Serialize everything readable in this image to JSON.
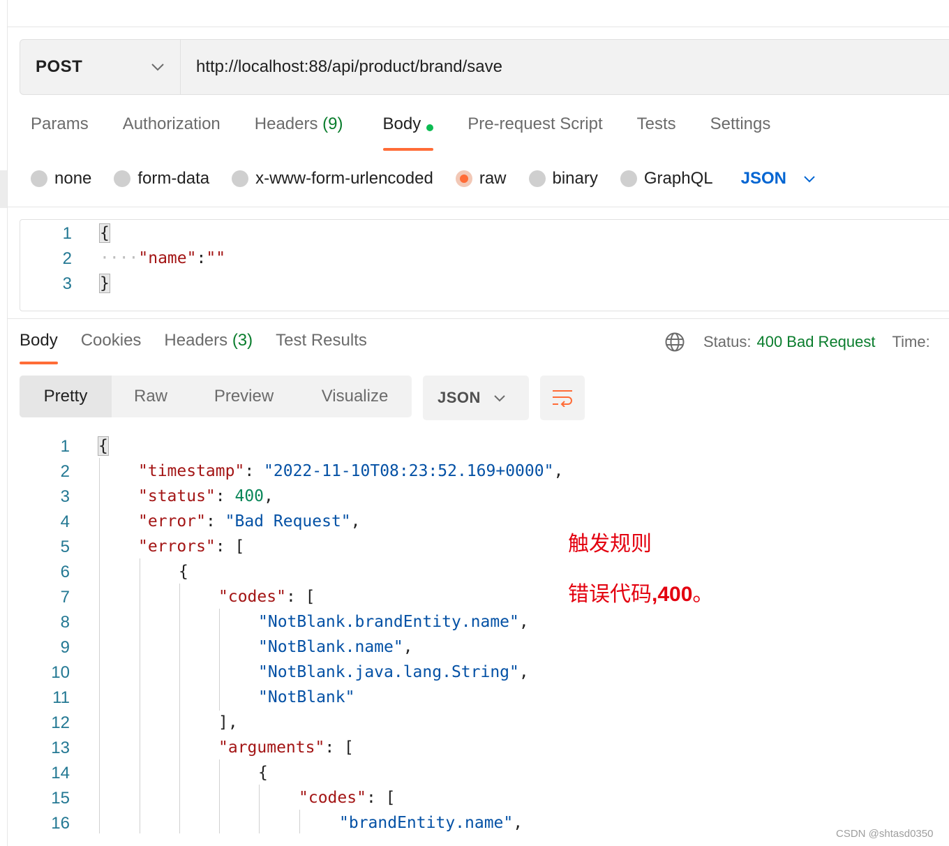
{
  "request": {
    "method": "POST",
    "url": "http://localhost:88/api/product/brand/save"
  },
  "request_tabs": [
    {
      "label": "Params"
    },
    {
      "label": "Authorization"
    },
    {
      "label": "Headers",
      "count": "(9)"
    },
    {
      "label": "Body",
      "active": true,
      "indicator": "green-dot"
    },
    {
      "label": "Pre-request Script"
    },
    {
      "label": "Tests"
    },
    {
      "label": "Settings"
    }
  ],
  "body_types": [
    {
      "label": "none"
    },
    {
      "label": "form-data"
    },
    {
      "label": "x-www-form-urlencoded"
    },
    {
      "label": "raw",
      "selected": true
    },
    {
      "label": "binary"
    },
    {
      "label": "GraphQL"
    }
  ],
  "body_language": "JSON",
  "request_body_lines": [
    "1",
    "2",
    "3"
  ],
  "request_body": {
    "open": "{",
    "key": "\"name\"",
    "colon": ":",
    "value": "\"\"",
    "close": "}"
  },
  "response_tabs": [
    {
      "label": "Body",
      "active": true
    },
    {
      "label": "Cookies"
    },
    {
      "label": "Headers",
      "count": "(3)"
    },
    {
      "label": "Test Results"
    }
  ],
  "status": {
    "label": "Status:",
    "value": "400 Bad Request",
    "time_label": "Time:"
  },
  "view_modes": [
    "Pretty",
    "Raw",
    "Preview",
    "Visualize"
  ],
  "response_format": "JSON",
  "response_lines": [
    "1",
    "2",
    "3",
    "4",
    "5",
    "6",
    "7",
    "8",
    "9",
    "10",
    "11",
    "12",
    "13",
    "14",
    "15",
    "16"
  ],
  "response": {
    "timestamp_key": "\"timestamp\"",
    "timestamp_val": "\"2022-11-10T08:23:52.169+0000\"",
    "status_key": "\"status\"",
    "status_val": "400",
    "error_key": "\"error\"",
    "error_val": "\"Bad Request\"",
    "errors_key": "\"errors\"",
    "codes_key": "\"codes\"",
    "code1": "\"NotBlank.brandEntity.name\"",
    "code2": "\"NotBlank.name\"",
    "code3": "\"NotBlank.java.lang.String\"",
    "code4": "\"NotBlank\"",
    "arguments_key": "\"arguments\"",
    "arg_code1": "\"brandEntity.name\""
  },
  "annotation": {
    "line1": "触发规则",
    "line2_prefix": "错误代码",
    "line2_bold": ",400",
    "line2_suffix": "。"
  },
  "watermark": "CSDN @shtasd0350",
  "colors": {
    "accent": "#ff6c37",
    "link_blue": "#0265d2",
    "success_green": "#0a7d2d",
    "annotation_red": "#e3000f"
  }
}
